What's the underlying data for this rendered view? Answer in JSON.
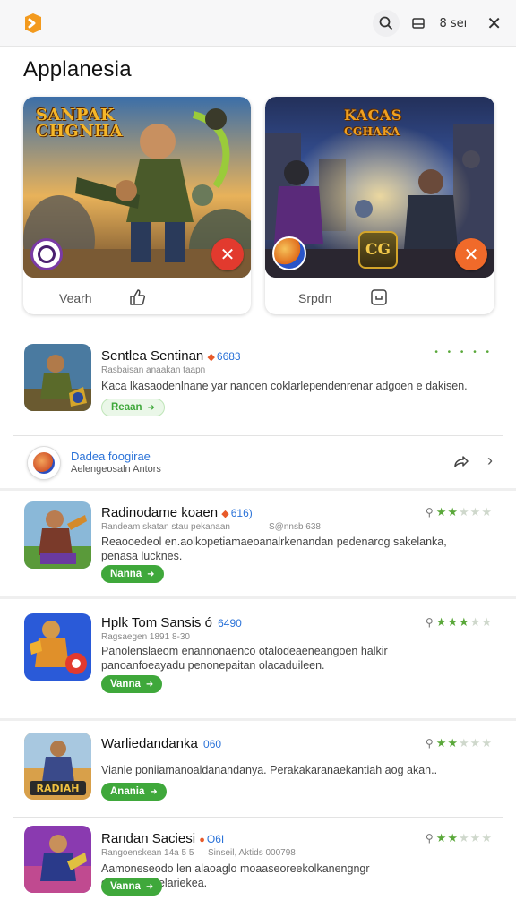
{
  "colors": {
    "accent": "#3fa83b",
    "brand": "#f39a1e",
    "link": "#2a72d8",
    "danger": "#e23a2e"
  },
  "topbar": {
    "logo_icon": "brand-logo-icon",
    "search_icon": "search-icon",
    "window_icon": "window-icon",
    "user_label": "8 ѕeı",
    "close_icon": "close-icon"
  },
  "app_title": "Applanesia",
  "featured": [
    {
      "banner_title_1": "SANPAK",
      "banner_title_2": "CHGNHA",
      "footer_label": "Vearh",
      "footer_icon": "thumbs-up-icon",
      "badge_icon": "circle-badge-icon",
      "action_icon": "close-icon"
    },
    {
      "banner_title_1": "KACAS",
      "banner_title_2": "CGHAKA",
      "badge_text": "CG",
      "footer_label": "Srpdn",
      "footer_icon": "refresh-icon",
      "action_icon": "close-icon"
    }
  ],
  "apps": [
    {
      "title": "Sentlea Sentinan",
      "version": "6683",
      "subtitle": "Rasbaisan anaakan taapn",
      "description": "Kaca lkasaodenlnane yar nanoen coklarlependenrenar adgoen e dakisen.",
      "button": "Reaan",
      "stars": 5,
      "rating_on": 0,
      "rating_style": "dots"
    },
    {
      "title": "Radinodame koaen",
      "version": "616)",
      "subtitle": "Randeam skatan stau pekanaan",
      "subtitle2": "S@nnsb 638",
      "description": "Reaooedeol en.aolkopetiamaeoanalrkenandan pedenarog sakelanka, penasa lucknes.",
      "button": "Nanna",
      "stars": 5,
      "rating_on": 2
    },
    {
      "title": "Hplk Tom Sansis ó",
      "version": "6490",
      "subtitle": "Ragsaegen 1891 8-30",
      "description": "Panolenslaeom enannonaenco otalodeaeneangoen halkir panoanfoeayadu penonepaitan olacaduileen.",
      "button": "Vanna",
      "stars": 5,
      "rating_on": 3
    },
    {
      "title": "Warliedandanka",
      "version": "060",
      "subtitle": "",
      "description": "Vianie poniiamanoaldanandanya. Perakakaranaekantiah aog akan..",
      "button": "Anania",
      "stars": 5,
      "rating_on": 2
    },
    {
      "title": "Randan Saciesi",
      "version": "O6I",
      "subtitle": "Rangoenskean 14a 5 5",
      "subtitle2": "Sinseil, Aktids 000798",
      "description": "Aamoneseodo len alaoaglo moaaseoreekolkanengngr deaalgn.aclelariekea.",
      "button": "Vanna",
      "stars": 5,
      "rating_on": 2
    }
  ],
  "promo": {
    "title": "Dadea foogirae",
    "subtitle": "Aelengeosaln Antors",
    "share_icon": "share-icon",
    "chevron_icon": "chevron-right-icon"
  }
}
